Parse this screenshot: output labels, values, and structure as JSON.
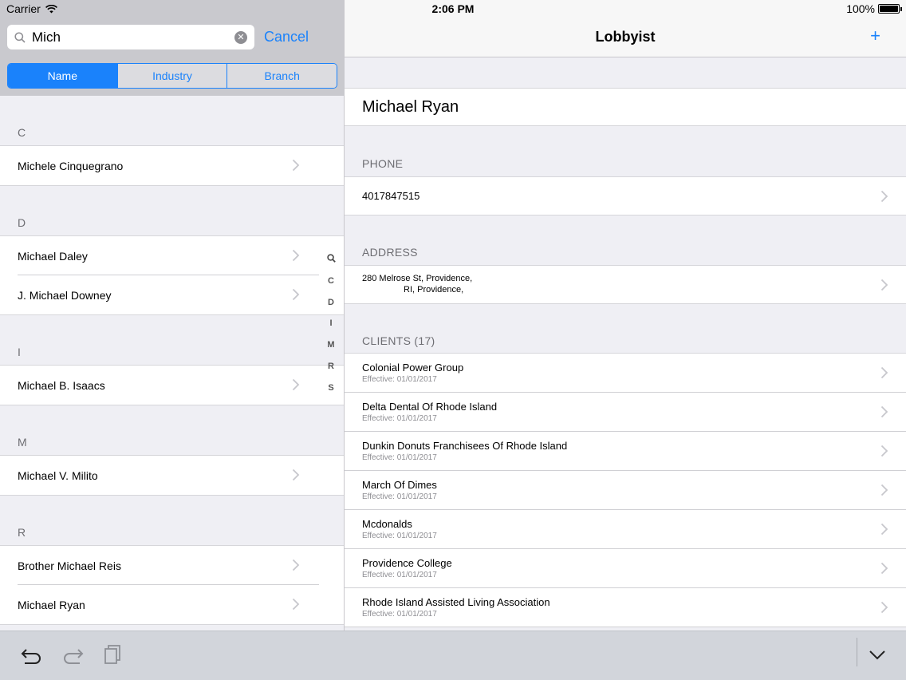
{
  "status_bar": {
    "carrier": "Carrier",
    "time": "2:06 PM",
    "battery": "100%"
  },
  "search": {
    "value": "Mich",
    "cancel_label": "Cancel"
  },
  "segments": [
    {
      "label": "Name",
      "selected": true
    },
    {
      "label": "Industry",
      "selected": false
    },
    {
      "label": "Branch",
      "selected": false
    }
  ],
  "sections": [
    {
      "letter": "C",
      "items": [
        "Michele Cinquegrano"
      ]
    },
    {
      "letter": "D",
      "items": [
        "Michael Daley",
        "J. Michael Downey"
      ]
    },
    {
      "letter": "I",
      "items": [
        "Michael B. Isaacs"
      ]
    },
    {
      "letter": "M",
      "items": [
        "Michael V. Milito"
      ]
    },
    {
      "letter": "R",
      "items": [
        "Brother Michael Reis",
        "Michael Ryan"
      ]
    }
  ],
  "index": [
    "C",
    "D",
    "I",
    "M",
    "R",
    "S"
  ],
  "detail": {
    "title": "Lobbyist",
    "add_label": "+",
    "name": "Michael Ryan",
    "phone_header": "PHONE",
    "phone": "4017847515",
    "address_header": "ADDRESS",
    "address_line1": "280 Melrose St, Providence,",
    "address_line2": "RI, Providence,",
    "clients_header": "CLIENTS (17)",
    "clients": [
      {
        "name": "Colonial Power Group",
        "effective": "Effective: 01/01/2017"
      },
      {
        "name": "Delta Dental Of Rhode Island",
        "effective": "Effective: 01/01/2017"
      },
      {
        "name": "Dunkin Donuts Franchisees Of Rhode Island",
        "effective": "Effective: 01/01/2017"
      },
      {
        "name": "March Of Dimes",
        "effective": "Effective: 01/01/2017"
      },
      {
        "name": "Mcdonalds",
        "effective": "Effective: 01/01/2017"
      },
      {
        "name": "Providence College",
        "effective": "Effective: 01/01/2017"
      },
      {
        "name": "Rhode Island Assisted Living Association",
        "effective": "Effective: 01/01/2017"
      }
    ]
  },
  "colors": {
    "accent": "#1a82fb",
    "background": "#efeff4"
  }
}
